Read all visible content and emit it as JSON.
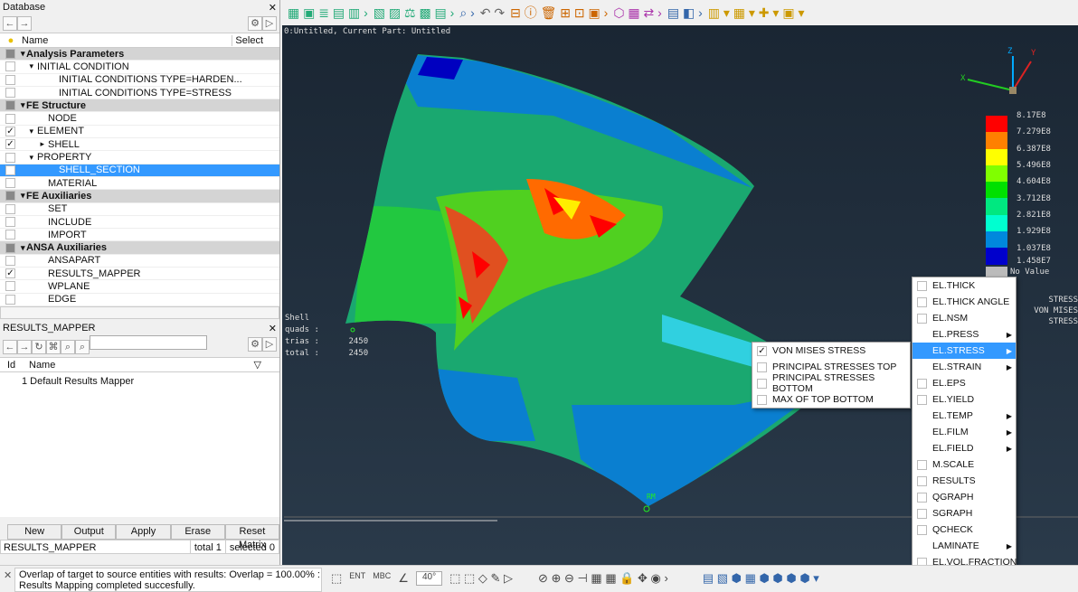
{
  "database": {
    "title": "Database",
    "col_name": "Name",
    "col_select": "Select",
    "rows": [
      {
        "label": "Analysis Parameters",
        "level": 0,
        "group": true,
        "check": "",
        "expand": "▾"
      },
      {
        "label": "INITIAL CONDITION",
        "level": 1,
        "check": "",
        "expand": "▾"
      },
      {
        "label": "INITIAL CONDITIONS TYPE=HARDEN...",
        "level": 3,
        "check": ""
      },
      {
        "label": "INITIAL CONDITIONS TYPE=STRESS",
        "level": 3,
        "check": ""
      },
      {
        "label": "FE Structure",
        "level": 0,
        "group": true,
        "check": "",
        "expand": "▾"
      },
      {
        "label": "NODE",
        "level": 2,
        "check": ""
      },
      {
        "label": "ELEMENT",
        "level": 1,
        "check": "✓",
        "expand": "▾"
      },
      {
        "label": "SHELL",
        "level": 2,
        "check": "✓",
        "expand": "▸"
      },
      {
        "label": "PROPERTY",
        "level": 1,
        "check": "",
        "expand": "▾"
      },
      {
        "label": "SHELL_SECTION",
        "level": 3,
        "check": "",
        "selected": true
      },
      {
        "label": "MATERIAL",
        "level": 2,
        "check": ""
      },
      {
        "label": "FE Auxiliaries",
        "level": 0,
        "group": true,
        "check": "",
        "expand": "▾"
      },
      {
        "label": "SET",
        "level": 2,
        "check": ""
      },
      {
        "label": "INCLUDE",
        "level": 2,
        "check": ""
      },
      {
        "label": "IMPORT",
        "level": 2,
        "check": ""
      },
      {
        "label": "ANSA Auxiliaries",
        "level": 0,
        "group": true,
        "check": "",
        "expand": "▾"
      },
      {
        "label": "ANSAPART",
        "level": 2,
        "check": ""
      },
      {
        "label": "RESULTS_MAPPER",
        "level": 2,
        "check": "✓"
      },
      {
        "label": "WPLANE",
        "level": 2,
        "check": ""
      },
      {
        "label": "EDGE",
        "level": 2,
        "check": ""
      }
    ]
  },
  "results_mapper": {
    "title": "RESULTS_MAPPER",
    "col_id": "Id",
    "col_name": "Name",
    "items": [
      "1 Default Results Mapper"
    ],
    "buttons": [
      "New",
      "Output",
      "Apply",
      "Erase",
      "Reset Matrix"
    ],
    "status_name": "RESULTS_MAPPER",
    "total": "total 1",
    "selected": "selected 0"
  },
  "messages": [
    "Overlap of target to source entities with results: Overlap = 100.00% :",
    "Results Mapping completed succesfully."
  ],
  "viewport": {
    "header": "0:Untitled,  Current Part: Untitled",
    "stats": [
      "Shell",
      "quads :",
      "trias :      2450",
      "total :      2450"
    ],
    "node_label": "RM",
    "axes": {
      "x": "X",
      "y": "Y",
      "z": "Z"
    },
    "legend": {
      "values": [
        "8.17E8",
        "7.279E8",
        "6.387E8",
        "5.496E8",
        "4.604E8",
        "3.712E8",
        "2.821E8",
        "1.929E8",
        "1.037E8",
        "1.458E7"
      ],
      "colors": [
        "#ff0000",
        "#ff8000",
        "#ffff00",
        "#80ff00",
        "#00e000",
        "#00e880",
        "#00ffd0",
        "#0088dd",
        "#0000cc"
      ],
      "no_value": "No Value",
      "title1": "STRESS",
      "title2": "VON MISES STRESS"
    }
  },
  "context_menu": {
    "items": [
      {
        "label": "EL.THICK",
        "check": true
      },
      {
        "label": "EL.THICK ANGLE",
        "check": true
      },
      {
        "label": "EL.NSM",
        "check": true
      },
      {
        "label": "EL.PRESS",
        "sub": true
      },
      {
        "label": "EL.STRESS",
        "sub": true,
        "highlight": true
      },
      {
        "label": "EL.STRAIN",
        "sub": true
      },
      {
        "label": "EL.EPS",
        "check": true
      },
      {
        "label": "EL.YIELD",
        "check": true
      },
      {
        "label": "EL.TEMP",
        "sub": true
      },
      {
        "label": "EL.FILM",
        "sub": true
      },
      {
        "label": "EL.FIELD",
        "sub": true
      },
      {
        "label": "M.SCALE",
        "check": true
      },
      {
        "label": "RESULTS",
        "check": true
      },
      {
        "label": "QGRAPH",
        "check": true
      },
      {
        "label": "SGRAPH",
        "check": true
      },
      {
        "label": "QCHECK",
        "check": true
      },
      {
        "label": "LAMINATE",
        "sub": true
      },
      {
        "label": "EL.VOL.FRACTION",
        "check": true
      }
    ],
    "submenu": [
      {
        "label": "VON MISES STRESS",
        "checked": true
      },
      {
        "label": "PRINCIPAL STRESSES TOP",
        "checked": false
      },
      {
        "label": "PRINCIPAL STRESSES BOTTOM",
        "checked": false
      },
      {
        "label": "MAX OF TOP BOTTOM",
        "checked": false
      }
    ]
  },
  "bottom_toolbar": {
    "ent": "ENT",
    "mbc": "MBC",
    "angle": "40°"
  }
}
